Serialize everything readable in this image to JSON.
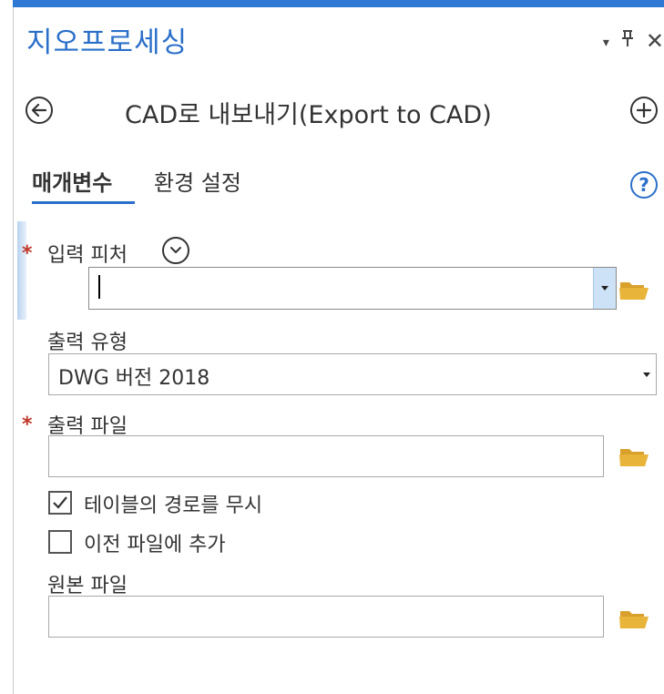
{
  "panel": {
    "title": "지오프로세싱",
    "controls": {
      "dropdown": "▾",
      "pin": "ᵽ",
      "close": "✕"
    }
  },
  "tool": {
    "title": "CAD로 내보내기(Export to CAD)",
    "back_icon": "arrow-left-circle-icon",
    "add_icon": "plus-circle-icon"
  },
  "tabs": [
    {
      "label": "매개변수",
      "active": true
    },
    {
      "label": "환경 설정",
      "active": false
    }
  ],
  "help": {
    "symbol": "?"
  },
  "params": {
    "input_features": {
      "label": "입력 피처",
      "required": true,
      "value": ""
    },
    "output_type": {
      "label": "출력 유형",
      "value": "DWG 버전 2018"
    },
    "output_file": {
      "label": "출력 파일",
      "required": true,
      "value": ""
    },
    "ignore_paths": {
      "label": "테이블의 경로를 무시",
      "checked": true
    },
    "append": {
      "label": "이전 파일에 추가",
      "checked": false
    },
    "seed_file": {
      "label": "원본 파일",
      "value": ""
    }
  },
  "required_marker": "*",
  "colors": {
    "accent": "#2a6fc9",
    "required": "#c0392b",
    "folder": "#e8b43a"
  }
}
